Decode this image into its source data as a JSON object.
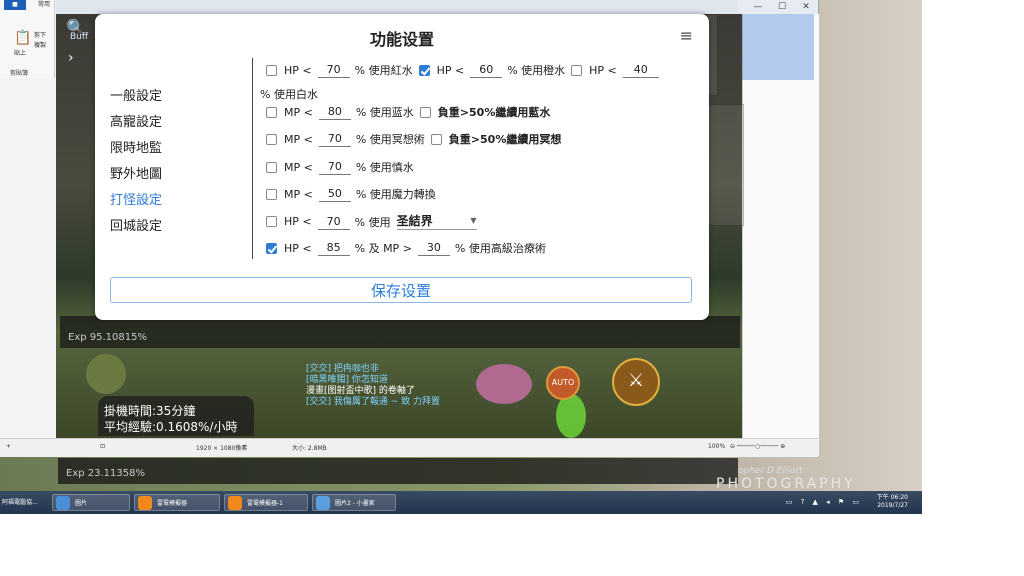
{
  "dialog": {
    "title": "功能设置",
    "menu_icon": "menu-icon",
    "nav": [
      "一般設定",
      "高寵設定",
      "限時地監",
      "野外地圖",
      "打怪設定",
      "回城設定"
    ],
    "active_nav": "打怪設定",
    "save_label": "保存设置"
  },
  "settings": {
    "row1": {
      "hp_a": "HP <",
      "v1": "70",
      "use_red": "% 使用紅水",
      "hp_b": "HP <",
      "v2": "60",
      "use_orange": "% 使用橙水",
      "hp_c": "HP <",
      "v3": "40",
      "use_white": "% 使用白水",
      "check1": false,
      "check2": true,
      "check3": false
    },
    "row2": {
      "label": "MP <",
      "value": "80",
      "text": "% 使用蓝水",
      "extra": "負重>50%繼續用藍水",
      "check": false,
      "extra_check": false
    },
    "row3": {
      "label": "MP <",
      "value": "70",
      "text": "% 使用冥想術",
      "extra": "負重>50%繼續用冥想",
      "check": false,
      "extra_check": false
    },
    "row4": {
      "label": "MP <",
      "value": "70",
      "text": "% 使用慎水",
      "check": false
    },
    "row5": {
      "label": "MP <",
      "value": "50",
      "text": "% 使用魔力轉換",
      "check": false
    },
    "row6": {
      "label": "HP <",
      "value": "70",
      "text": "% 使用",
      "select": "圣結界",
      "check": false
    },
    "row7": {
      "label": "HP <",
      "value": "85",
      "mid": "% 及 MP >",
      "value2": "30",
      "text": "% 使用高級治療術",
      "check": true
    }
  },
  "game": {
    "exp_top": "Exp 95.10815%",
    "exp_bottom": "Exp 23.11358%",
    "hang_time": "掛機時間:35分鐘",
    "avg_exp": "平均經驗:0.1608%/小時",
    "chat": [
      "[交交] 把冉咖也非",
      "[暗黑唯獨] 你怎知道",
      "漫畫[图射盃中歌] 的卷軸了",
      "[交交] 我傷厲了報通 ~ 致 力拜置"
    ],
    "auto_label": "AUTO",
    "buff_label": "Buff"
  },
  "paint": {
    "tab_file": "■",
    "tab_home": "常用",
    "paste": "貼上",
    "cut": "剪下",
    "copy": "複製",
    "clipboard": "剪貼簿",
    "dims": "1920 × 1080像素",
    "size": "大小: 2.8MB",
    "zoom": "100%"
  },
  "taskbar": {
    "items": [
      "阿福電腦協...",
      "圖片",
      "雷電模擬器",
      "雷電模擬器-1",
      "圖片2 - 小畫家"
    ],
    "time": "下午 06:20",
    "date": "2019/7/27"
  },
  "wallpaper": {
    "credit1": "opher D Elliott",
    "credit2": "PHOTOGRAPHY"
  }
}
